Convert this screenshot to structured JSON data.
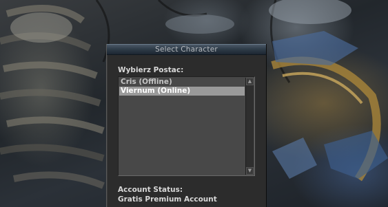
{
  "dialog": {
    "title": "Select Character",
    "prompt_label": "Wybierz Postac:",
    "characters": [
      {
        "label": "Cris (Offline)",
        "selected": false
      },
      {
        "label": "Viernum (Online)",
        "selected": true
      }
    ],
    "account_status_label": "Account Status:",
    "account_status_value": "Gratis Premium Account"
  },
  "colors": {
    "titlebar": "#2f3c49",
    "dialog_bg": "#2c2c2c",
    "listbox_bg": "#484848",
    "selection": "#9a9a9a"
  },
  "icons": {
    "scroll_up": "arrow-up-icon",
    "scroll_down": "arrow-down-icon"
  }
}
